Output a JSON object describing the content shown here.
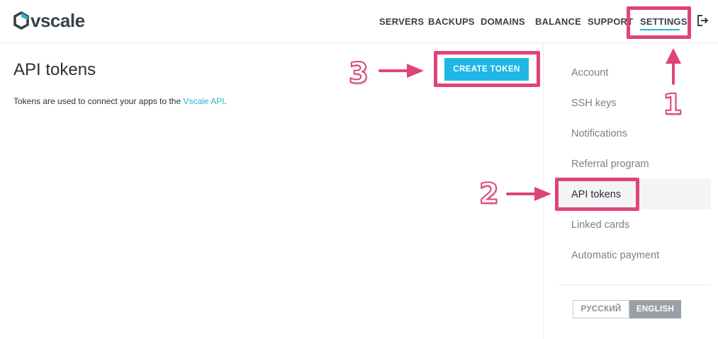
{
  "header": {
    "logo_text": "vscale",
    "nav": [
      "SERVERS",
      "BACKUPS",
      "DOMAINS",
      "BALANCE",
      "SUPPORT",
      "SETTINGS"
    ],
    "active_nav": "SETTINGS"
  },
  "main": {
    "title": "API tokens",
    "description_prefix": "Tokens are used to connect your apps to the ",
    "description_link": "Vscale API",
    "description_suffix": ".",
    "create_button": "CREATE TOKEN"
  },
  "sidebar": {
    "items": [
      "Account",
      "SSH keys",
      "Notifications",
      "Referral program",
      "API tokens",
      "Linked cards",
      "Automatic payment"
    ],
    "active_item": "API tokens",
    "languages": [
      "РУССКИЙ",
      "ENGLISH"
    ],
    "active_language": "ENGLISH"
  },
  "annotations": {
    "steps": [
      "1",
      "2",
      "3"
    ]
  },
  "colors": {
    "accent": "#27b6c9",
    "button": "#1fb7e6",
    "highlight": "#e0437a"
  },
  "icons": {
    "logo": "vscale-hexagon-logo-icon",
    "logout": "logout-icon"
  }
}
